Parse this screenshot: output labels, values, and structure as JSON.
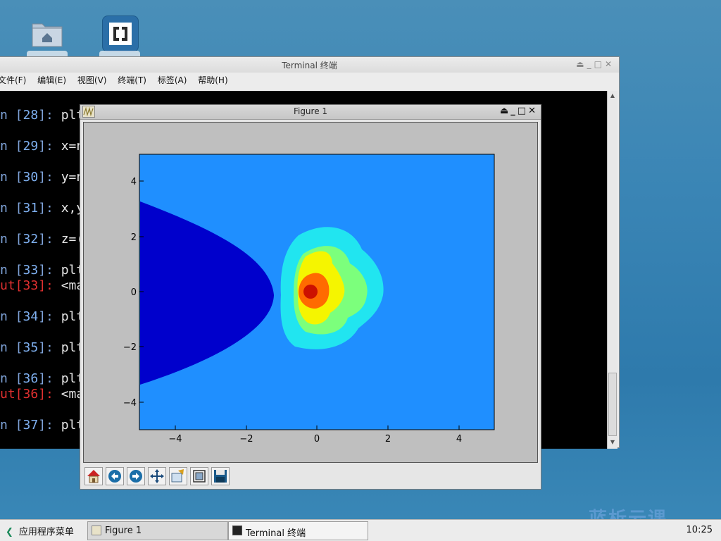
{
  "desktop": {
    "icons": [
      {
        "name": "home-folder",
        "icon": "home-folder-icon"
      },
      {
        "name": "app-launcher",
        "icon": "bracket-app-icon"
      }
    ]
  },
  "terminal": {
    "title": "Terminal 终端",
    "menu": [
      "文件(F)",
      "编辑(E)",
      "视图(V)",
      "终端(T)",
      "标签(A)",
      "帮助(H)"
    ],
    "lines": [
      {
        "prefix": "n [",
        "num": "28",
        "suffix": "]: ",
        "code": "plt",
        "kind": "in"
      },
      {
        "prefix": "n [",
        "num": "29",
        "suffix": "]: ",
        "code": "x=n",
        "kind": "in"
      },
      {
        "prefix": "n [",
        "num": "30",
        "suffix": "]: ",
        "code": "y=n",
        "kind": "in"
      },
      {
        "prefix": "n [",
        "num": "31",
        "suffix": "]: ",
        "code": "x,y",
        "kind": "in"
      },
      {
        "prefix": "n [",
        "num": "32",
        "suffix": "]: ",
        "code": "z=(",
        "kind": "in"
      },
      {
        "prefix": "n [",
        "num": "33",
        "suffix": "]: ",
        "code": "plt",
        "kind": "in"
      },
      {
        "prefix": "ut[",
        "num": "33",
        "suffix": "]: ",
        "code": "<ma",
        "kind": "out"
      },
      {
        "prefix": "n [",
        "num": "34",
        "suffix": "]: ",
        "code": "plt",
        "kind": "in"
      },
      {
        "prefix": "n [",
        "num": "35",
        "suffix": "]: ",
        "code": "plt",
        "kind": "in"
      },
      {
        "prefix": "n [",
        "num": "36",
        "suffix": "]: ",
        "code": "plt",
        "kind": "in"
      },
      {
        "prefix": "ut[",
        "num": "36",
        "suffix": "]: ",
        "code": "<ma",
        "kind": "out"
      },
      {
        "prefix": "n [",
        "num": "37",
        "suffix": "]: ",
        "code": "plt",
        "kind": "in"
      }
    ]
  },
  "figure": {
    "title": "Figure 1",
    "xticks": [
      "−4",
      "−2",
      "0",
      "2",
      "4"
    ],
    "yticks": [
      "4",
      "2",
      "0",
      "−2",
      "−4"
    ],
    "toolbar": [
      {
        "name": "home-icon"
      },
      {
        "name": "back-arrow-icon"
      },
      {
        "name": "forward-arrow-icon"
      },
      {
        "name": "pan-move-icon"
      },
      {
        "name": "zoom-rect-icon"
      },
      {
        "name": "subplots-config-icon"
      },
      {
        "name": "save-floppy-icon"
      }
    ],
    "colors": {
      "background": "#1f8fff",
      "outer": "#0000cc",
      "cyan": "#21e5f0",
      "green": "#7cff7c",
      "yellow": "#f5f500",
      "orange": "#ff6b00",
      "red": "#cc1100"
    }
  },
  "taskbar": {
    "start_label": "应用程序菜单",
    "tasks": [
      {
        "label": "Figure 1",
        "active": true
      },
      {
        "label": "Terminal 终端",
        "active": false
      }
    ],
    "clock": "10:25",
    "watermark": "蓝析云课"
  }
}
